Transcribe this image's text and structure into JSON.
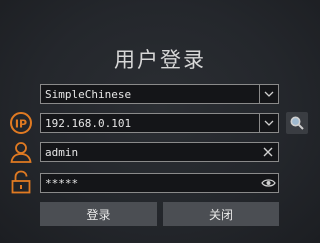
{
  "login": {
    "title": "用户登录",
    "language": "SimpleChinese",
    "ip": "192.168.0.101",
    "username": "admin",
    "password": "*****",
    "login_label": "登录",
    "close_label": "关闭"
  },
  "colors": {
    "accent": "#e07a22",
    "background": "#24272c",
    "field_bg": "#141518",
    "button_bg": "#4b4e53"
  }
}
